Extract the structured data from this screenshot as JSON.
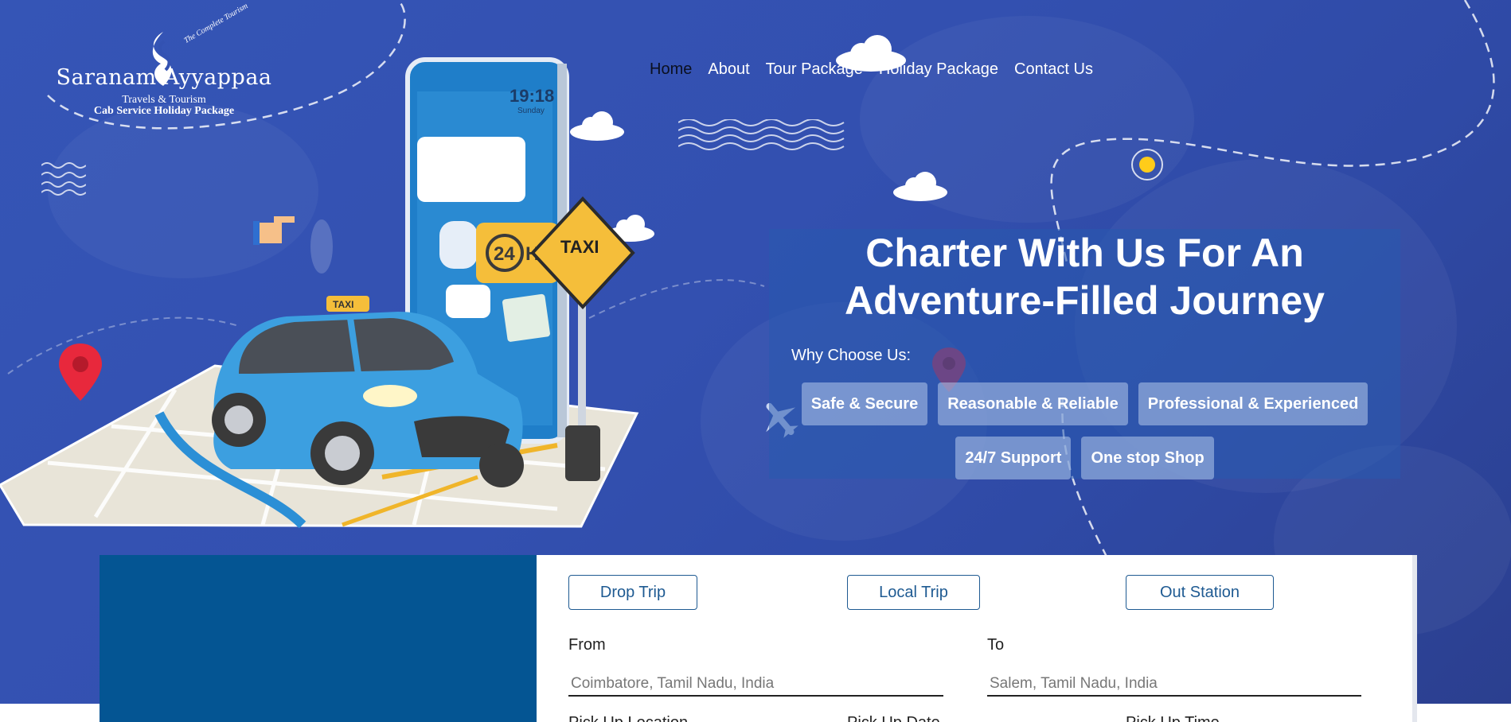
{
  "brand": {
    "tagline": "The Complete Tourism",
    "name": "Saranam Ayyappaa",
    "subtitle": "Travels & Tourism",
    "services": "Cab Service  Holiday Package"
  },
  "nav": {
    "items": [
      "Home",
      "About",
      "Tour Package",
      "Holiday Package",
      "Contact Us"
    ],
    "active": "Home"
  },
  "hero": {
    "headline_line1": "Charter With Us For An",
    "headline_line2": "Adventure-Filled Journey",
    "why_label": "Why Choose Us:",
    "features_row1": [
      "Safe & Secure",
      "Reasonable & Reliable",
      "Professional & Experienced"
    ],
    "features_row2": [
      "24/7 Support",
      "One stop Shop"
    ]
  },
  "illustration": {
    "phone_time": "19:18",
    "phone_day": "Sunday",
    "badge_24": "24",
    "badge_hr": "HR",
    "sign_text": "TAXI",
    "car_roof_sign": "TAXI"
  },
  "booking": {
    "trip_types": [
      "Drop Trip",
      "Local Trip",
      "Out Station"
    ],
    "from_label": "From",
    "from_placeholder": "Coimbatore, Tamil Nadu, India",
    "to_label": "To",
    "to_placeholder": "Salem, Tamil Nadu, India",
    "pickup_location_label": "Pick Up Location",
    "pickup_date_label": "Pick Up Date",
    "pickup_time_label": "Pick Up Time"
  },
  "colors": {
    "hero_bg": "#3352b2",
    "panel": "#2f5aa8",
    "booking_left": "#045593",
    "trip_button": "#1e5a92"
  }
}
